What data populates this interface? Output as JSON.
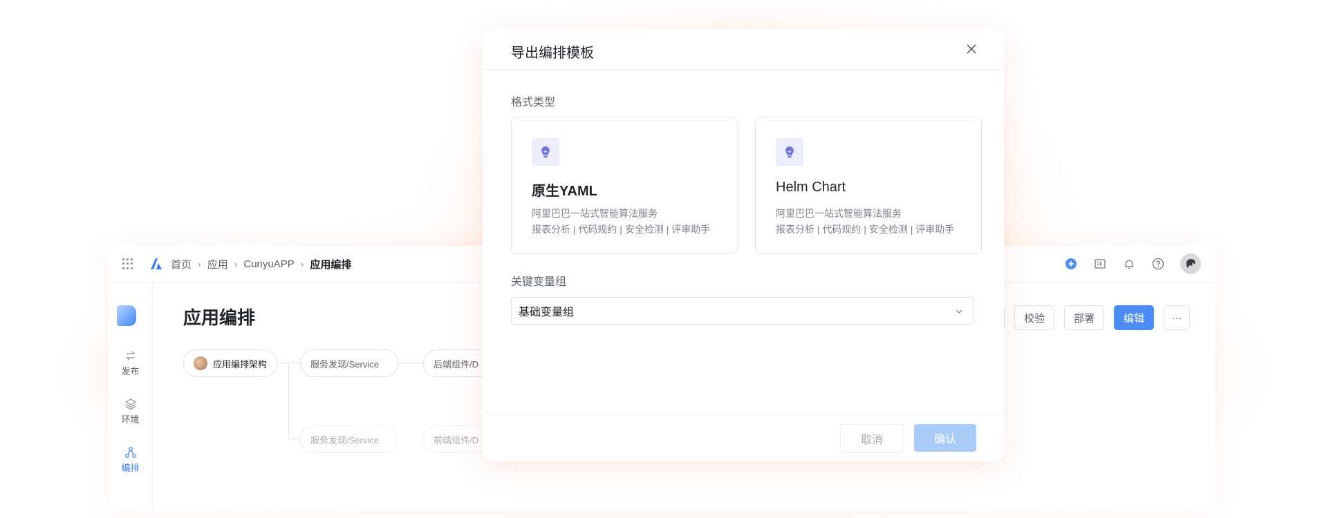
{
  "topbar": {
    "breadcrumb": [
      "首页",
      "应用",
      "CunyuAPP",
      "应用编排"
    ],
    "separator": "›"
  },
  "sidebar": {
    "items": [
      {
        "label": "发布",
        "icon": "swap-arrows-icon"
      },
      {
        "label": "环境",
        "icon": "layers-icon"
      },
      {
        "label": "编排",
        "icon": "topology-icon"
      }
    ]
  },
  "page": {
    "title": "应用编排"
  },
  "graph": {
    "root": "应用编排架构",
    "nodes": [
      "服务发现/Service",
      "后端组件/D",
      "服务发现/Service",
      "前端组件/D"
    ]
  },
  "actions": {
    "validate": "校验",
    "deploy": "部署",
    "edit": "编辑",
    "more": "···"
  },
  "modal": {
    "title": "导出编排模板",
    "format_label": "格式类型",
    "cards": [
      {
        "title": "原生YAML",
        "desc1": "阿里巴巴一站式智能算法服务",
        "desc2": "报表分析 | 代码规约 | 安全检测 | 评审助手"
      },
      {
        "title": "Helm Chart",
        "desc1": "阿里巴巴一站式智能算法服务",
        "desc2": "报表分析 | 代码规约 | 安全检测 | 评审助手"
      }
    ],
    "vargroup_label": "关键变量组",
    "vargroup_value": "基础变量组",
    "cancel": "取消",
    "confirm": "确认"
  },
  "colors": {
    "primary": "#4e8cf5",
    "confirm_disabled": "#a9cbf6",
    "icon_accent": "#6f74d8"
  }
}
